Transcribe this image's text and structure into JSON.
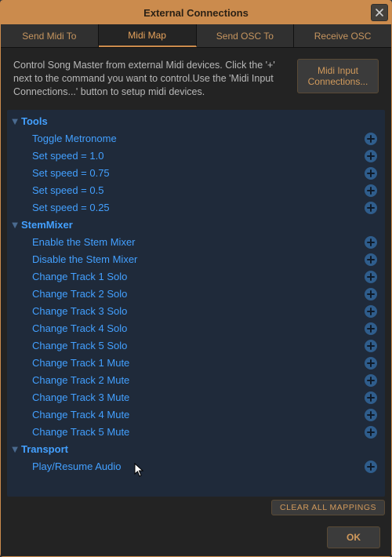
{
  "window": {
    "title": "External Connections"
  },
  "tabs": [
    "Send Midi To",
    "Midi Map",
    "Send OSC To",
    "Receive OSC"
  ],
  "active_tab_index": 1,
  "info_text": "Control Song Master from external Midi devices. Click the '+' next to the command you want to control.Use the 'Midi Input Connections...' button to setup midi devices.",
  "buttons": {
    "midi_input": "Midi Input\nConnections...",
    "clear_all": "CLEAR ALL MAPPINGS",
    "ok": "OK"
  },
  "tree": [
    {
      "category": "Tools",
      "items": [
        "Toggle Metronome",
        "Set speed = 1.0",
        "Set speed = 0.75",
        "Set speed = 0.5",
        "Set speed = 0.25"
      ]
    },
    {
      "category": "StemMixer",
      "items": [
        "Enable the Stem Mixer",
        "Disable the Stem Mixer",
        "Change Track 1 Solo",
        "Change Track 2 Solo",
        "Change Track 3 Solo",
        "Change Track 4 Solo",
        "Change Track 5 Solo",
        "Change Track 1 Mute",
        "Change Track 2 Mute",
        "Change Track 3 Mute",
        "Change Track 4 Mute",
        "Change Track 5 Mute"
      ]
    },
    {
      "category": "Transport",
      "items": [
        "Play/Resume Audio"
      ]
    }
  ]
}
